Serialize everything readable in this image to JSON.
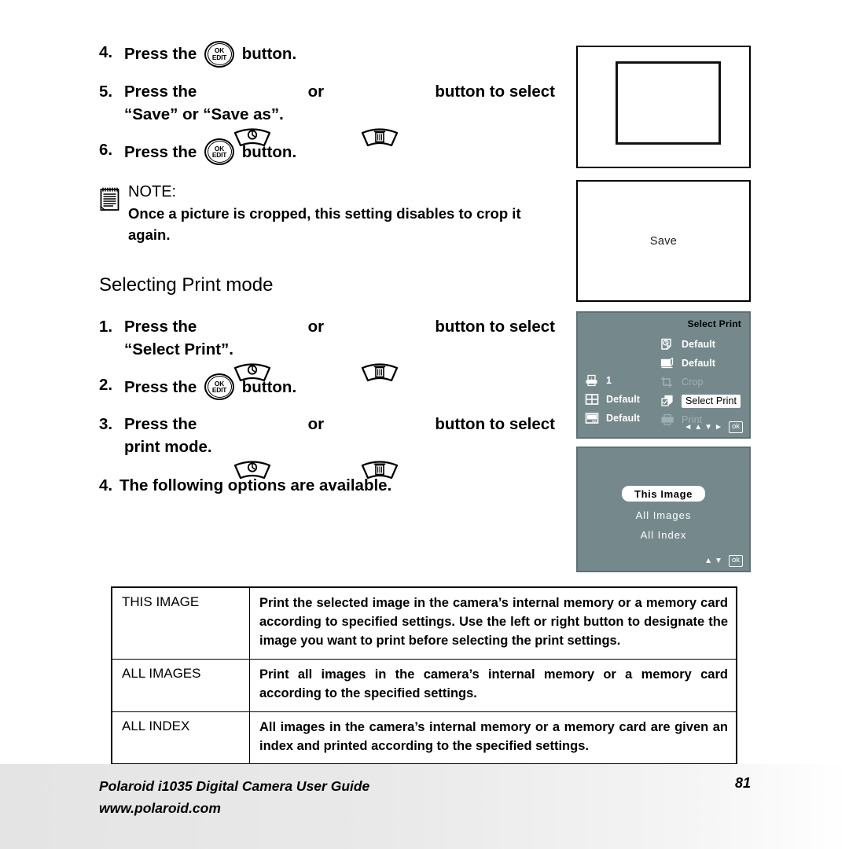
{
  "steps_crop": [
    {
      "num": "4.",
      "pre": "Press the ",
      "button": "ok-edit-button",
      "post": " button."
    },
    {
      "num": "5.",
      "pre": "Press the ",
      "button_a": "self-timer-button",
      "mid": " or ",
      "button_b": "delete-button",
      "post": " button to select",
      "line2": "“Save” or “Save as”."
    },
    {
      "num": "6.",
      "pre": "Press the ",
      "button": "ok-edit-button",
      "post": " button."
    }
  ],
  "note": {
    "icon": "notepad-icon",
    "title": "NOTE:",
    "text": "Once a picture is cropped, this setting disables to crop it again."
  },
  "section": {
    "heading": "Selecting Print mode"
  },
  "steps_print": [
    {
      "num": "1.",
      "pre": "Press the ",
      "button_a": "self-timer-button",
      "mid": " or ",
      "button_b": "delete-button",
      "post": " button to select",
      "line2": "“Select Print”."
    },
    {
      "num": "2.",
      "pre": "Press the ",
      "button": "ok-edit-button",
      "post": " button."
    },
    {
      "num": "3.",
      "pre": "Press the ",
      "button_a": "self-timer-button",
      "mid": " or ",
      "button_b": "delete-button",
      "post": " button to select",
      "line2": "print mode."
    },
    {
      "num": "4.",
      "text": "The following options are available."
    }
  ],
  "screens": {
    "crop_preview": {
      "name": "crop-preview-screen"
    },
    "save_screen": {
      "label": "Save"
    },
    "select_print_menu": {
      "title": "Select Print",
      "right_items": [
        {
          "icon": "quality-icon",
          "label": "Default",
          "state": "normal"
        },
        {
          "icon": "paper-size-icon",
          "label": "Default",
          "state": "normal"
        },
        {
          "icon": "crop-icon",
          "label": "Crop",
          "state": "dim"
        },
        {
          "icon": "select-print-icon",
          "label": "Select Print",
          "state": "selected"
        },
        {
          "icon": "print-icon",
          "label": "Print",
          "state": "dim"
        }
      ],
      "left_items": [
        {
          "icon": "copies-printer-icon",
          "label": "1"
        },
        {
          "icon": "layout-grid-icon",
          "label": "Default"
        },
        {
          "icon": "date-stamp-icon",
          "label": "Default"
        }
      ],
      "nav": {
        "left": "◄",
        "up": "▲",
        "down": "▼",
        "right": "►",
        "ok": "ok"
      }
    },
    "print_mode_menu": {
      "items": [
        {
          "label": "This Image",
          "state": "selected"
        },
        {
          "label": "All Images",
          "state": "normal"
        },
        {
          "label": "All Index",
          "state": "normal"
        }
      ],
      "nav": {
        "up": "▲",
        "down": "▼",
        "ok": "ok"
      }
    }
  },
  "options_table": {
    "rows": [
      {
        "key": "THIS IMAGE",
        "desc": "Print the selected image in the camera’s internal memory or a memory card according to specified settings. Use the left or right button to designate the image you want to print before selecting the print settings."
      },
      {
        "key": "ALL IMAGES",
        "desc": "Print all images in the camera’s internal memory or a memory card according to the specified settings."
      },
      {
        "key": "ALL INDEX",
        "desc": "All images in the camera’s internal memory or a memory card are given an index and printed according to the specified settings."
      }
    ]
  },
  "footer": {
    "line1": "Polaroid i1035 Digital Camera User Guide",
    "line2": "www.polaroid.com",
    "page": "81"
  },
  "colors": {
    "lcd_background": "#75898c",
    "lcd_border": "#5e7174",
    "text": "#000000",
    "dim_text": "#9fb0b2",
    "footer_band": "#e6e6e6"
  }
}
